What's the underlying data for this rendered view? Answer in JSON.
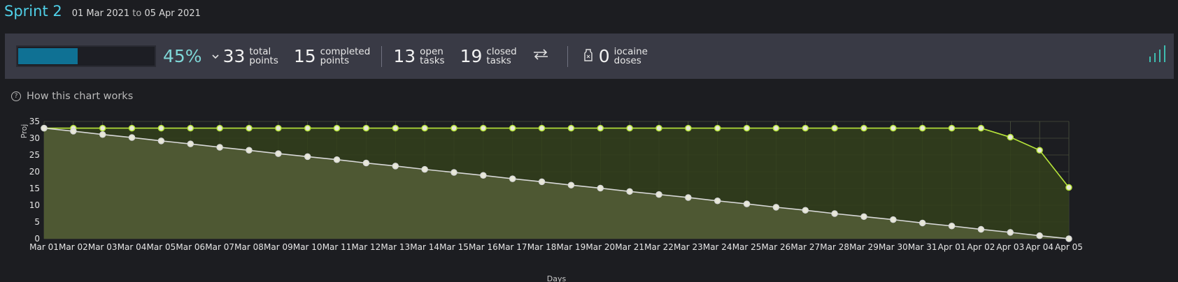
{
  "sprint": {
    "title": "Sprint 2",
    "start": "01 Mar 2021",
    "to_word": "to",
    "end": "05 Apr 2021"
  },
  "summary": {
    "progress_fraction": 0.45,
    "percent": "45%",
    "total_points": {
      "value": "33",
      "label1": "total",
      "label2": "points"
    },
    "completed_points": {
      "value": "15",
      "label1": "completed",
      "label2": "points"
    },
    "open_tasks": {
      "value": "13",
      "label1": "open",
      "label2": "tasks"
    },
    "closed_tasks": {
      "value": "19",
      "label1": "closed",
      "label2": "tasks"
    },
    "iocaine": {
      "value": "0",
      "label1": "iocaine",
      "label2": "doses"
    },
    "colors": {
      "accent": "#4fd0e8",
      "progress": "#0f7194",
      "percent": "#7fd7d7",
      "stats_icon": "#3fbdb0"
    }
  },
  "help_link": "How this chart works",
  "chart_data": {
    "type": "area",
    "xlabel": "Days",
    "ylabel": "Proj",
    "ylim": [
      0,
      35
    ],
    "yticks": [
      0,
      5,
      10,
      15,
      20,
      25,
      30,
      35
    ],
    "grid": true,
    "categories": [
      "Mar 01",
      "Mar 02",
      "Mar 03",
      "Mar 04",
      "Mar 05",
      "Mar 06",
      "Mar 07",
      "Mar 08",
      "Mar 09",
      "Mar 10",
      "Mar 11",
      "Mar 12",
      "Mar 13",
      "Mar 14",
      "Mar 15",
      "Mar 16",
      "Mar 17",
      "Mar 18",
      "Mar 19",
      "Mar 20",
      "Mar 21",
      "Mar 22",
      "Mar 23",
      "Mar 24",
      "Mar 25",
      "Mar 26",
      "Mar 27",
      "Mar 28",
      "Mar 29",
      "Mar 30",
      "Mar 31",
      "Apr 01",
      "Apr 02",
      "Apr 03",
      "Apr 04",
      "Apr 05"
    ],
    "series": [
      {
        "values": [
          33,
          33,
          33,
          33,
          33,
          33,
          33,
          33,
          33,
          33,
          33,
          33,
          33,
          33,
          33,
          33,
          33,
          33,
          33,
          33,
          33,
          33,
          33,
          33,
          33,
          33,
          33,
          33,
          33,
          33,
          33,
          33,
          33,
          30.3,
          26.4,
          15.3
        ],
        "color": "#b7e53a",
        "fill": "#333f1b"
      },
      {
        "values": [
          33,
          32.1,
          31.1,
          30.2,
          29.2,
          28.3,
          27.3,
          26.4,
          25.4,
          24.5,
          23.6,
          22.6,
          21.7,
          20.7,
          19.8,
          18.9,
          17.9,
          17.0,
          16.0,
          15.1,
          14.1,
          13.2,
          12.3,
          11.3,
          10.4,
          9.4,
          8.5,
          7.5,
          6.6,
          5.7,
          4.7,
          3.8,
          2.8,
          1.9,
          0.9,
          0
        ],
        "color": "#d8d8d8",
        "fill": "#505a35"
      }
    ],
    "colors": {
      "background": "#1c1d21",
      "grid": "#5b6446",
      "tick_text": "#e6e6e6"
    }
  }
}
